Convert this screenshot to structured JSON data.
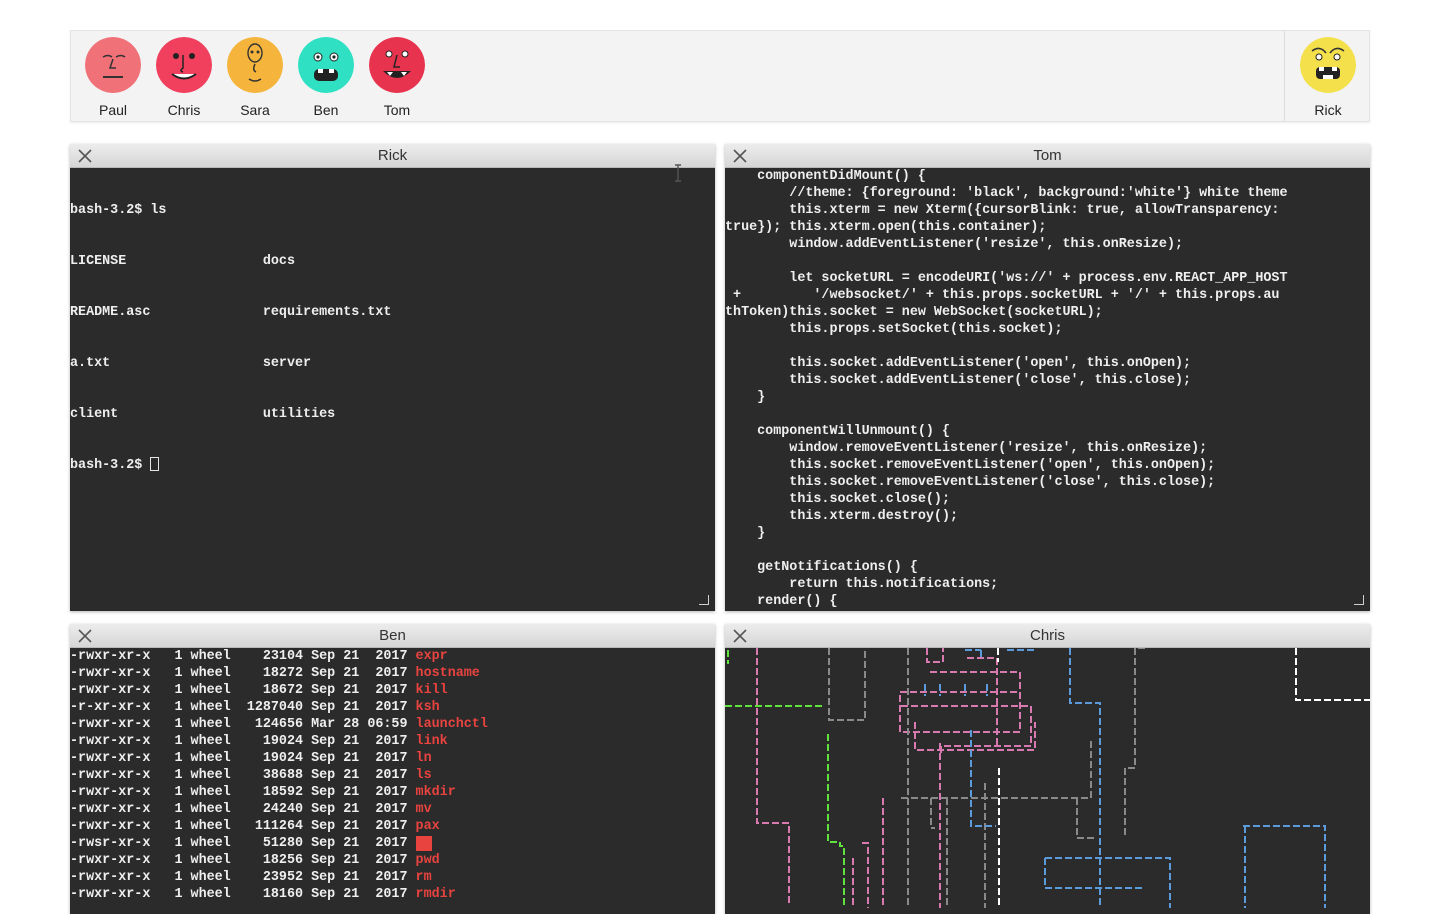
{
  "users": [
    {
      "name": "Paul",
      "color": "#f07178"
    },
    {
      "name": "Chris",
      "color": "#f0405e"
    },
    {
      "name": "Sara",
      "color": "#f5b53d"
    },
    {
      "name": "Ben",
      "color": "#2fe0c2"
    },
    {
      "name": "Tom",
      "color": "#e8334f"
    }
  ],
  "self_user": {
    "name": "Rick",
    "color": "#f3e04a"
  },
  "windows": {
    "rick": {
      "title": "Rick",
      "lines": [
        "bash-3.2$ ls",
        "LICENSE                 docs",
        "README.asc              requirements.txt",
        "a.txt                   server",
        "client                  utilities"
      ],
      "prompt": "bash-3.2$ "
    },
    "tom": {
      "title": "Tom",
      "lines": [
        "    componentDidMount() {",
        "        //theme: {foreground: 'black', background:'white'} white theme",
        "        this.xterm = new Xterm({cursorBlink: true, allowTransparency:",
        "true}); this.xterm.open(this.container);",
        "        window.addEventListener('resize', this.onResize);",
        "",
        "        let socketURL = encodeURI('ws://' + process.env.REACT_APP_HOST",
        " +         '/websocket/' + this.props.socketURL + '/' + this.props.au",
        "thToken)this.socket = new WebSocket(socketURL);",
        "        this.props.setSocket(this.socket);",
        "",
        "        this.socket.addEventListener('open', this.onOpen);",
        "        this.socket.addEventListener('close', this.close);",
        "    }",
        "",
        "    componentWillUnmount() {",
        "        window.removeEventListener('resize', this.onResize);",
        "        this.socket.removeEventListener('open', this.onOpen);",
        "        this.socket.removeEventListener('close', this.close);",
        "        this.socket.close();",
        "        this.xterm.destroy();",
        "    }",
        "",
        "    getNotifications() {",
        "        return this.notifications;",
        "    render() {"
      ]
    },
    "ben": {
      "title": "Ben",
      "rows": [
        {
          "meta": "-rwxr-xr-x   1 wheel    23104 Sep 21  2017 ",
          "name": "expr"
        },
        {
          "meta": "-rwxr-xr-x   1 wheel    18272 Sep 21  2017 ",
          "name": "hostname"
        },
        {
          "meta": "-rwxr-xr-x   1 wheel    18672 Sep 21  2017 ",
          "name": "kill"
        },
        {
          "meta": "-r-xr-xr-x   1 wheel  1287040 Sep 21  2017 ",
          "name": "ksh"
        },
        {
          "meta": "-rwxr-xr-x   1 wheel   124656 Mar 28 06:59 ",
          "name": "launchctl"
        },
        {
          "meta": "-rwxr-xr-x   1 wheel    19024 Sep 21  2017 ",
          "name": "link"
        },
        {
          "meta": "-rwxr-xr-x   1 wheel    19024 Sep 21  2017 ",
          "name": "ln"
        },
        {
          "meta": "-rwxr-xr-x   1 wheel    38688 Sep 21  2017 ",
          "name": "ls"
        },
        {
          "meta": "-rwxr-xr-x   1 wheel    18592 Sep 21  2017 ",
          "name": "mkdir"
        },
        {
          "meta": "-rwxr-xr-x   1 wheel    24240 Sep 21  2017 ",
          "name": "mv"
        },
        {
          "meta": "-rwxr-xr-x   1 wheel   111264 Sep 21  2017 ",
          "name": "pax"
        },
        {
          "meta": "-rwsr-xr-x   1 wheel    51280 Sep 21  2017 ",
          "name": "ps"
        },
        {
          "meta": "-rwxr-xr-x   1 wheel    18256 Sep 21  2017 ",
          "name": "pwd"
        },
        {
          "meta": "-rwxr-xr-x   1 wheel    23952 Sep 21  2017 ",
          "name": "rm"
        },
        {
          "meta": "-rwxr-xr-x   1 wheel    18160 Sep 21  2017 ",
          "name": "rmdir"
        }
      ]
    },
    "chris": {
      "title": "Chris"
    }
  }
}
